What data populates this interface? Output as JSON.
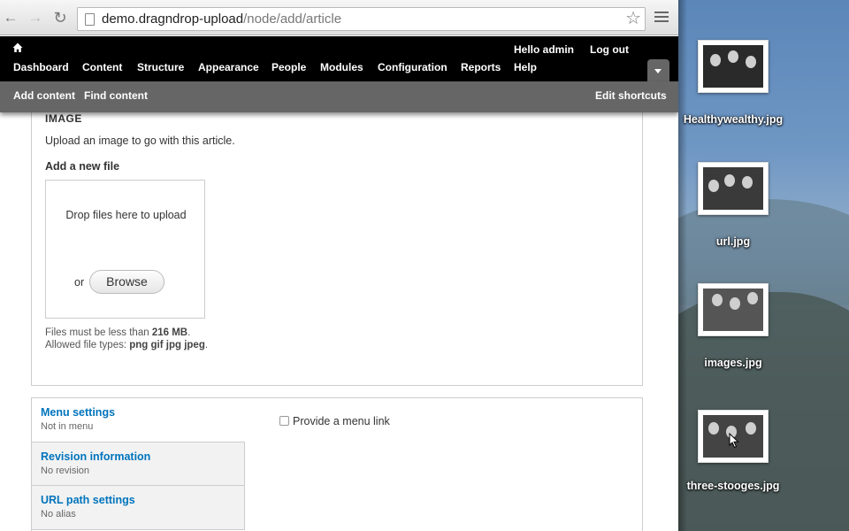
{
  "browser": {
    "url_host": "demo.dragndrop-upload",
    "url_path": "/node/add/article"
  },
  "toolbar": {
    "items": [
      "Dashboard",
      "Content",
      "Structure",
      "Appearance",
      "People",
      "Modules",
      "Configuration",
      "Reports"
    ],
    "greeting_prefix": "Hello ",
    "username": "admin",
    "logout": "Log out",
    "help": "Help"
  },
  "shortcuts": {
    "add_content": "Add content",
    "find_content": "Find content",
    "edit_shortcuts": "Edit shortcuts"
  },
  "image_field": {
    "legend": "IMAGE",
    "description": "Upload an image to go with this article.",
    "add_new_file": "Add a new file",
    "drop_text": "Drop files here to upload",
    "or": "or",
    "browse": "Browse",
    "size_prefix": "Files must be less than ",
    "size_value": "216 MB",
    "size_suffix": ".",
    "types_prefix": "Allowed file types: ",
    "types_value": "png gif jpg jpeg",
    "types_suffix": "."
  },
  "vertical_tabs": [
    {
      "title": "Menu settings",
      "summary": "Not in menu"
    },
    {
      "title": "Revision information",
      "summary": "No revision"
    },
    {
      "title": "URL path settings",
      "summary": "No alias"
    }
  ],
  "menu_settings": {
    "provide_menu_link": "Provide a menu link",
    "checked": false
  },
  "desktop_files": [
    {
      "name": "Healthywealthy.jpg"
    },
    {
      "name": "url.jpg"
    },
    {
      "name": "images.jpg"
    },
    {
      "name": "three-stooges.jpg"
    }
  ],
  "colors": {
    "toolbar_bg": "#000000",
    "shortcut_bg": "#666666",
    "link_blue": "#0074bd"
  }
}
